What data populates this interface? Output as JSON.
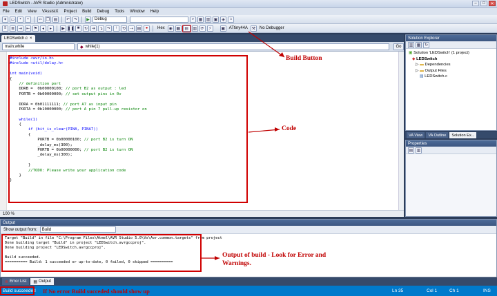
{
  "window": {
    "title": "LEDSwitch - AVR Studio (Administrator)",
    "controls": [
      "–",
      "□",
      "✕"
    ]
  },
  "menu": [
    "File",
    "Edit",
    "View",
    "VAssistX",
    "Project",
    "Build",
    "Debug",
    "Tools",
    "Window",
    "Help"
  ],
  "toolbar": {
    "config": "Debug",
    "hex_label": "Hex",
    "device": "ATtiny44A",
    "debugger": "No Debugger"
  },
  "editor": {
    "tab": "LEDSwitch.c",
    "tab_close": "×",
    "scope": "main.while",
    "function": "while(1)",
    "go": "Go",
    "zoom": "100 %",
    "code": [
      {
        "t": "pp",
        "s": "#include <avr/io.h>"
      },
      {
        "t": "pp",
        "s": "#include <util/delay.h>"
      },
      {
        "t": "",
        "s": ""
      },
      {
        "t": "kw",
        "s": "int main(void)"
      },
      {
        "t": "",
        "s": "{"
      },
      {
        "t": "cm",
        "s": "    // definition port"
      },
      {
        "t": "mix",
        "s": "    DDRB =  0b00000100;",
        "c": " // port B2 as output : led"
      },
      {
        "t": "mix",
        "s": "    PORTB = 0b00000000;",
        "c": " // set output pins in 0v"
      },
      {
        "t": "",
        "s": ""
      },
      {
        "t": "mix",
        "s": "    DDRA = 0b01111111;",
        "c": " // port A7 as input pin"
      },
      {
        "t": "mix",
        "s": "    PORTA = 0b10000000;",
        "c": " // port A pin 7 pull-up resistor on"
      },
      {
        "t": "",
        "s": ""
      },
      {
        "t": "kw",
        "s": "    while(1)"
      },
      {
        "t": "",
        "s": "    {"
      },
      {
        "t": "kw",
        "s": "        if (bit_is_clear(PINA, PINA7))"
      },
      {
        "t": "",
        "s": "        {"
      },
      {
        "t": "mix",
        "s": "            PORTB = 0b00000100;",
        "c": " // port B2 is turn ON"
      },
      {
        "t": "",
        "s": "            _delay_ms(300);"
      },
      {
        "t": "mix",
        "s": "            PORTB = 0b00000000;",
        "c": " // port B2 is turn ON"
      },
      {
        "t": "",
        "s": "            _delay_ms(300);"
      },
      {
        "t": "",
        "s": ""
      },
      {
        "t": "",
        "s": "        }"
      },
      {
        "t": "cm",
        "s": "        //TODO: Please write your application code"
      },
      {
        "t": "",
        "s": "    }"
      },
      {
        "t": "",
        "s": "}"
      }
    ]
  },
  "annotations": {
    "build_button": "Build Button",
    "code": "Code",
    "output_line1": "Output of build - Look for Error and",
    "output_line2": "Warnings.",
    "status": "If No error Build succeded should show up"
  },
  "solution_explorer": {
    "title": "Solution Explorer",
    "items": [
      "Solution 'LEDSwitch' (1 project)",
      "LEDSwitch",
      "Dependencies",
      "Output Files",
      "LEDSwitch.c"
    ]
  },
  "side_tabs": [
    "VA View",
    "VA Outline",
    "Solution Ex..."
  ],
  "properties": {
    "title": "Properties"
  },
  "output": {
    "title": "Output",
    "show_from": "Show output from:",
    "source": "Build",
    "lines": [
      "Target \"Build\" in file \"C:\\Program Files\\Atmel\\AVR Studio 5.0\\Vs\\Avr.common.targets\" from project",
      "Done building target \"Build\" in project \"LEDSwitch.avrgccproj\".",
      "Done building project \"LEDSwitch.avrgccproj\".",
      "",
      "Build succeeded.",
      "========== Build: 1 succeeded or up-to-date, 0 failed, 0 skipped =========="
    ]
  },
  "bottom_tabs": [
    "Error List",
    "Output"
  ],
  "status": {
    "message": "Build succeeded",
    "ln": "Ln 35",
    "col": "Col 1",
    "ch": "Ch 1",
    "ins": "INS"
  },
  "colors": {
    "annotation": "#c00000",
    "status_bar": "#007acc"
  }
}
